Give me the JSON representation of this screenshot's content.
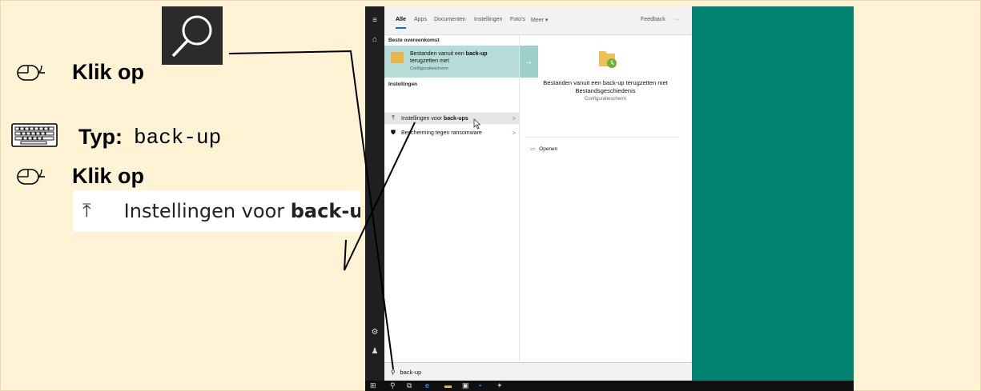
{
  "instructions": {
    "step1_label": "Klik op",
    "step2_label": "Typ:",
    "step2_value": "back-up",
    "step3_label": "Klik op",
    "snip_normal": "Instellingen voor ",
    "snip_bold": "back-u",
    "snip_icon": "⤒"
  },
  "screenshot": {
    "tabs": [
      "Alle",
      "Apps",
      "Documenten",
      "Instellingen",
      "Foto's",
      "Meer ▾"
    ],
    "feedback": "Feedback",
    "more_dots": "···",
    "best_match_header": "Beste overeenkomst",
    "best_match_title_normal": "Bestanden vanuit een ",
    "best_match_title_bold": "back-up",
    "best_match_title_rest": " terugzetten met",
    "best_match_sub": "Configuratiescherm",
    "best_match_arrow": "→",
    "settings_header": "Instellingen",
    "results": [
      {
        "icon": "⤒",
        "text_normal": "Instellingen voor ",
        "text_bold": "back-ups"
      },
      {
        "icon": "⛊",
        "text_normal": "Bescherming tegen ransomware",
        "text_bold": ""
      }
    ],
    "preview_title": "Bestanden vanuit een back-up terugzetten met Bestandsgeschiedenis",
    "preview_sub": "Configuratiescherm",
    "open_action": "Openen",
    "search_value": "back-up"
  },
  "colors": {
    "background": "#fff3d6",
    "desktop": "#008272",
    "accent": "#0078d7",
    "best_match": "#b5dcd7"
  }
}
